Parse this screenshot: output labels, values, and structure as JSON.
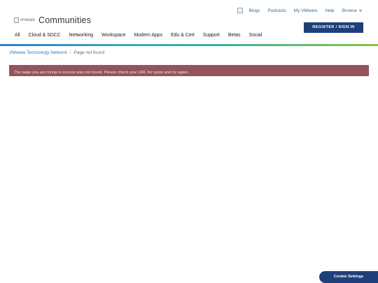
{
  "header": {
    "logo_alt": "vmware",
    "site_title": "Communities",
    "utility_links": [
      "Blogs",
      "Podcasts",
      "My VMware",
      "Help"
    ],
    "browse_label": "Browse",
    "register_label": "REGISTER / SIGN IN"
  },
  "main_nav": [
    "All",
    "Cloud & SDCC",
    "Networking",
    "Workspace",
    "Modern Apps",
    "Edu & Cert",
    "Support",
    "Betas",
    "Social"
  ],
  "breadcrumb": {
    "root": "VMware Technology Network",
    "separator": "›",
    "current": "Page not found"
  },
  "alert": {
    "message": "The page you are trying to access was not found. Please check your URL for typos and try again."
  },
  "cookie": {
    "label": "Cookie Settings"
  },
  "colors": {
    "brand_navy": "#1e3f7a",
    "link_blue": "#2f7fc0",
    "alert_bg": "#935559"
  }
}
